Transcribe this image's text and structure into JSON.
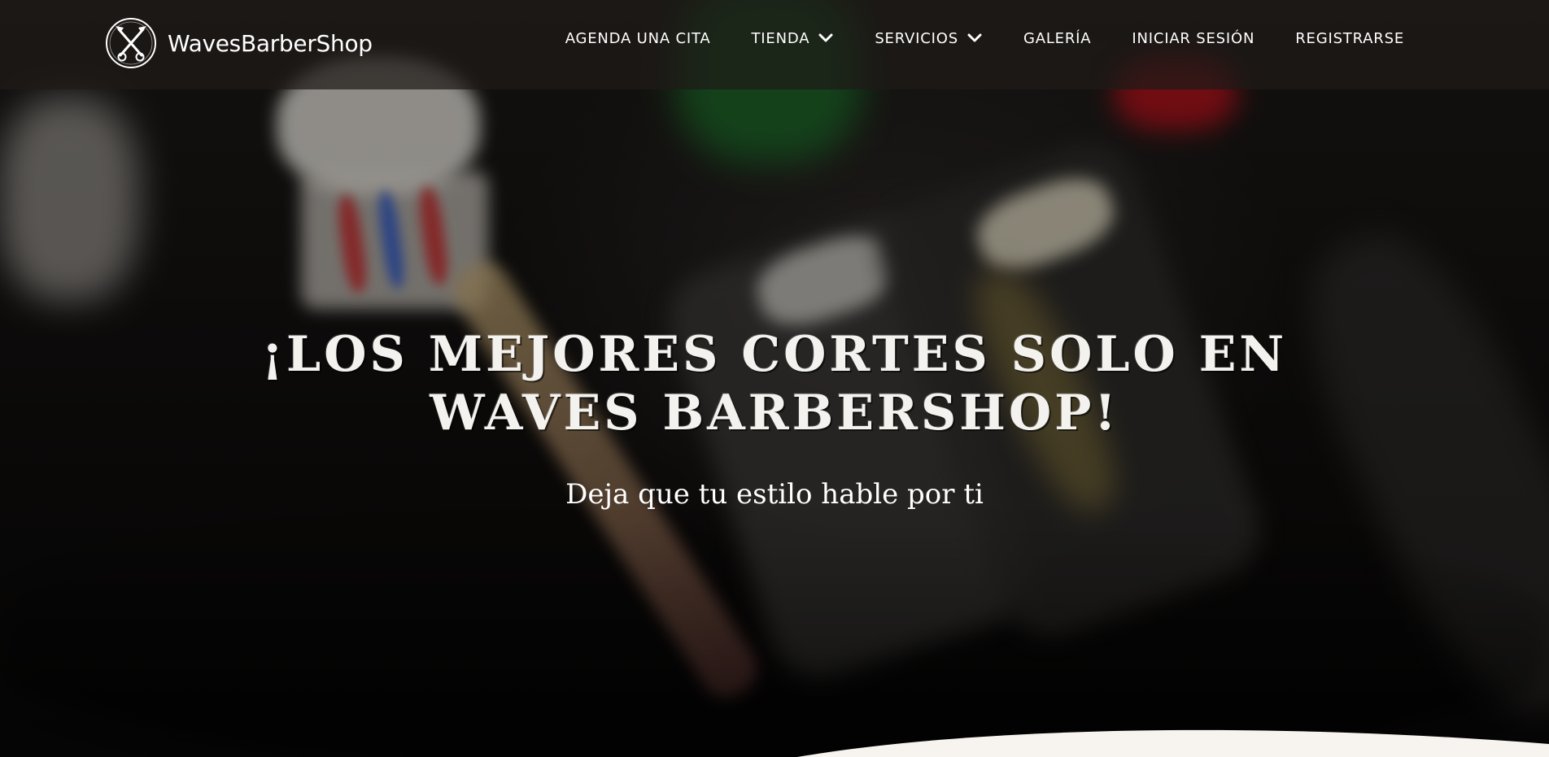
{
  "header": {
    "brand_name": "WavesBarberShop",
    "logo_icon": "crossed-razor-scissors-icon",
    "nav": {
      "agenda": "AGENDA UNA CITA",
      "tienda": "TIENDA",
      "servicios": "SERVICIOS",
      "galeria": "GALERÍA",
      "login": "INICIAR SESIÓN",
      "register": "REGISTRARSE"
    },
    "dropdown_icon": "chevron-down-icon"
  },
  "hero": {
    "title": "¡Los mejores cortes solo en Waves Barbershop!",
    "subtitle": "Deja que tu estilo hable por ti"
  },
  "colors": {
    "header_bg": "#1e1a18",
    "text": "#ffffff",
    "divider": "#f7f3ee"
  }
}
